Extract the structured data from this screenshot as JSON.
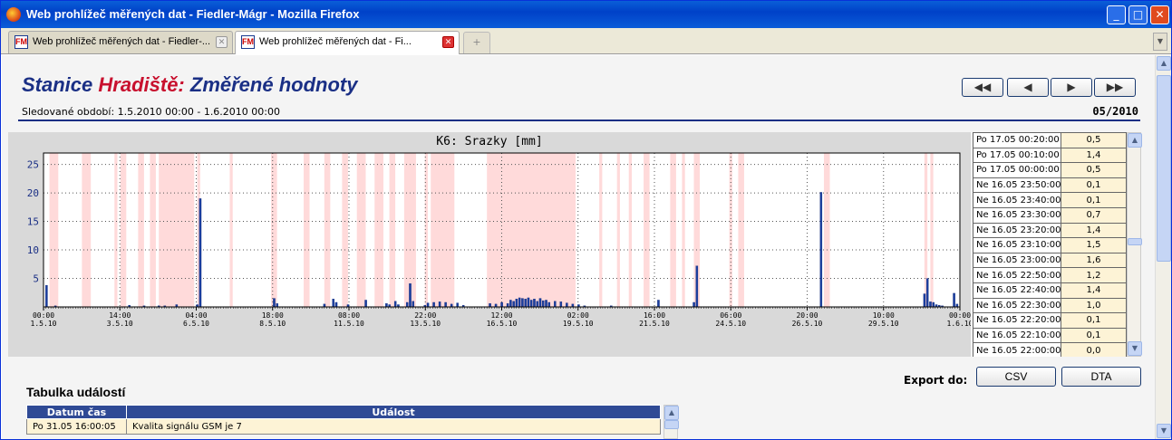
{
  "window": {
    "title": "Web prohlížeč měřených dat - Fiedler-Mágr - Mozilla Firefox"
  },
  "tabs": [
    {
      "label": "Web prohlížeč měřených dat - Fiedler-...",
      "icon": "FM"
    },
    {
      "label": "Web prohlížeč měřených dat - Fi...",
      "icon": "FM"
    }
  ],
  "page": {
    "heading_a": "Stanice",
    "heading_station": "Hradiště:",
    "heading_b": "Změřené hodnoty",
    "period": "Sledované období: 1.5.2010 00:00 - 1.6.2010 00:00",
    "month": "05/2010",
    "nav": {
      "first": "◀◀",
      "prev": "◀",
      "next": "▶",
      "last": "▶▶"
    }
  },
  "chart_data": {
    "type": "bar",
    "title": "K6: Srazky [mm]",
    "ylim": [
      0,
      27
    ],
    "yticks": [
      5,
      10,
      15,
      20,
      25
    ],
    "x_range_days": [
      0,
      31
    ],
    "xticks": [
      {
        "time": "00:00",
        "date": "1.5.10",
        "day": 0
      },
      {
        "time": "14:00",
        "date": "3.5.10",
        "day": 2.583
      },
      {
        "time": "04:00",
        "date": "6.5.10",
        "day": 5.167
      },
      {
        "time": "18:00",
        "date": "8.5.10",
        "day": 7.75
      },
      {
        "time": "08:00",
        "date": "11.5.10",
        "day": 10.333
      },
      {
        "time": "22:00",
        "date": "13.5.10",
        "day": 12.917
      },
      {
        "time": "12:00",
        "date": "16.5.10",
        "day": 15.5
      },
      {
        "time": "02:00",
        "date": "19.5.10",
        "day": 18.083
      },
      {
        "time": "16:00",
        "date": "21.5.10",
        "day": 20.667
      },
      {
        "time": "06:00",
        "date": "24.5.10",
        "day": 23.25
      },
      {
        "time": "20:00",
        "date": "26.5.10",
        "day": 25.833
      },
      {
        "time": "10:00",
        "date": "29.5.10",
        "day": 28.417
      },
      {
        "time": "00:00",
        "date": "1.6.10",
        "day": 31
      }
    ],
    "grid": true,
    "bars": [
      [
        0.1,
        3.8
      ],
      [
        0.4,
        0.2
      ],
      [
        2.9,
        0.3
      ],
      [
        3.4,
        0.2
      ],
      [
        3.9,
        0.2
      ],
      [
        4.1,
        0.2
      ],
      [
        4.5,
        0.4
      ],
      [
        5.2,
        0.4
      ],
      [
        5.3,
        19.0
      ],
      [
        7.8,
        1.5
      ],
      [
        7.9,
        0.6
      ],
      [
        9.5,
        0.5
      ],
      [
        9.8,
        1.4
      ],
      [
        9.9,
        0.8
      ],
      [
        10.3,
        0.4
      ],
      [
        10.9,
        1.2
      ],
      [
        11.6,
        0.6
      ],
      [
        11.7,
        0.4
      ],
      [
        11.9,
        1.0
      ],
      [
        12.0,
        0.4
      ],
      [
        12.3,
        0.8
      ],
      [
        12.4,
        4.1
      ],
      [
        12.5,
        1.0
      ],
      [
        12.9,
        0.3
      ],
      [
        13.0,
        0.7
      ],
      [
        13.2,
        0.8
      ],
      [
        13.4,
        0.9
      ],
      [
        13.6,
        0.8
      ],
      [
        13.8,
        0.5
      ],
      [
        14.0,
        0.7
      ],
      [
        14.2,
        0.3
      ],
      [
        15.1,
        0.6
      ],
      [
        15.3,
        0.5
      ],
      [
        15.5,
        0.8
      ],
      [
        15.7,
        0.6
      ],
      [
        15.8,
        1.2
      ],
      [
        15.9,
        1.0
      ],
      [
        16.0,
        1.4
      ],
      [
        16.1,
        1.6
      ],
      [
        16.2,
        1.5
      ],
      [
        16.3,
        1.4
      ],
      [
        16.4,
        1.6
      ],
      [
        16.5,
        1.2
      ],
      [
        16.6,
        1.4
      ],
      [
        16.7,
        1.0
      ],
      [
        16.8,
        1.5
      ],
      [
        16.9,
        1.1
      ],
      [
        17.0,
        1.2
      ],
      [
        17.1,
        0.8
      ],
      [
        17.3,
        1.0
      ],
      [
        17.5,
        0.9
      ],
      [
        17.7,
        0.7
      ],
      [
        17.9,
        0.5
      ],
      [
        18.1,
        0.4
      ],
      [
        18.3,
        0.2
      ],
      [
        19.2,
        0.2
      ],
      [
        20.8,
        1.2
      ],
      [
        22.0,
        0.8
      ],
      [
        22.1,
        7.2
      ],
      [
        26.3,
        20.1
      ],
      [
        29.8,
        2.3
      ],
      [
        29.9,
        5.0
      ],
      [
        30.0,
        0.9
      ],
      [
        30.1,
        0.8
      ],
      [
        30.2,
        0.4
      ],
      [
        30.3,
        0.3
      ],
      [
        30.4,
        0.2
      ],
      [
        30.8,
        2.4
      ],
      [
        30.9,
        0.5
      ]
    ],
    "highlight_periods": [
      [
        0.2,
        0.5
      ],
      [
        1.3,
        1.6
      ],
      [
        2.4,
        2.5
      ],
      [
        2.6,
        2.8
      ],
      [
        3.2,
        3.4
      ],
      [
        3.6,
        3.8
      ],
      [
        3.9,
        5.1
      ],
      [
        5.2,
        5.3
      ],
      [
        6.3,
        6.4
      ],
      [
        7.7,
        7.9
      ],
      [
        8.8,
        9.0
      ],
      [
        9.5,
        9.7
      ],
      [
        10.1,
        10.3
      ],
      [
        10.6,
        10.9
      ],
      [
        11.2,
        11.5
      ],
      [
        11.7,
        11.9
      ],
      [
        12.2,
        12.6
      ],
      [
        12.9,
        13.0
      ],
      [
        13.1,
        13.9
      ],
      [
        15.0,
        18.0
      ],
      [
        18.8,
        18.9
      ],
      [
        19.4,
        19.5
      ],
      [
        19.8,
        19.9
      ],
      [
        20.3,
        20.5
      ],
      [
        21.2,
        21.4
      ],
      [
        21.6,
        21.7
      ],
      [
        22.0,
        22.2
      ],
      [
        23.2,
        23.3
      ],
      [
        23.5,
        23.7
      ],
      [
        26.4,
        26.6
      ],
      [
        29.8,
        29.9
      ],
      [
        30.0,
        30.1
      ]
    ]
  },
  "values_table": [
    {
      "time": "Po 17.05 00:20:00",
      "value": "0,5"
    },
    {
      "time": "Po 17.05 00:10:00",
      "value": "1,4"
    },
    {
      "time": "Po 17.05 00:00:00",
      "value": "0,5"
    },
    {
      "time": "Ne 16.05 23:50:00",
      "value": "0,1"
    },
    {
      "time": "Ne 16.05 23:40:00",
      "value": "0,1"
    },
    {
      "time": "Ne 16.05 23:30:00",
      "value": "0,7"
    },
    {
      "time": "Ne 16.05 23:20:00",
      "value": "1,4"
    },
    {
      "time": "Ne 16.05 23:10:00",
      "value": "1,5"
    },
    {
      "time": "Ne 16.05 23:00:00",
      "value": "1,6"
    },
    {
      "time": "Ne 16.05 22:50:00",
      "value": "1,2"
    },
    {
      "time": "Ne 16.05 22:40:00",
      "value": "1,4"
    },
    {
      "time": "Ne 16.05 22:30:00",
      "value": "1,0"
    },
    {
      "time": "Ne 16.05 22:20:00",
      "value": "0,1"
    },
    {
      "time": "Ne 16.05 22:10:00",
      "value": "0,1"
    },
    {
      "time": "Ne 16.05 22:00:00",
      "value": "0,0"
    }
  ],
  "export": {
    "label": "Export do:",
    "csv": "CSV",
    "dta": "DTA"
  },
  "events": {
    "title": "Tabulka událostí",
    "col_time": "Datum čas",
    "col_event": "Událost",
    "rows": [
      {
        "time": "Po 31.05 16:00:05",
        "event": "Kvalita signálu GSM je 7"
      }
    ]
  },
  "colors": {
    "brand_blue": "#1a2f85",
    "station_red": "#c8102e",
    "bar_blue": "#1a3fa0",
    "highlight": "#ffdada"
  }
}
